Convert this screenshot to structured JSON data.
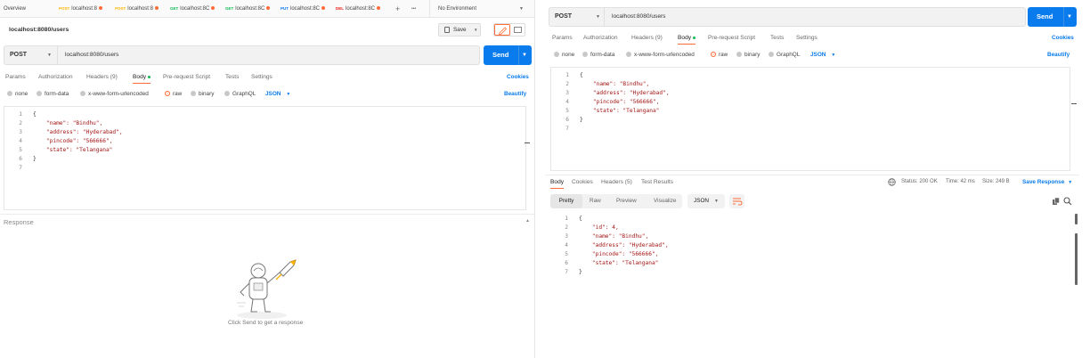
{
  "left": {
    "tabs": [
      {
        "label": "Overview",
        "method": ""
      },
      {
        "label": "localhost:8",
        "method": "POST"
      },
      {
        "label": "localhost:8",
        "method": "POST"
      },
      {
        "label": "localhost:8C",
        "method": "GET"
      },
      {
        "label": "localhost:8C",
        "method": "GET"
      },
      {
        "label": "localhost:8C",
        "method": "PUT"
      },
      {
        "label": "localhost:8C",
        "method": "DEL"
      }
    ],
    "tab_add": "+",
    "tab_more": "•••",
    "environment": "No Environment",
    "request_title": "localhost:8080/users",
    "save_label": "Save",
    "method": "POST",
    "url": "localhost:8080/users",
    "send_label": "Send",
    "subtabs": {
      "params": "Params",
      "auth": "Authorization",
      "headers": "Headers (9)",
      "body": "Body",
      "prerequest": "Pre-request Script",
      "tests": "Tests",
      "settings": "Settings",
      "cookies": "Cookies"
    },
    "body_types": {
      "none": "none",
      "form_data": "form-data",
      "urlencoded": "x-www-form-urlencoded",
      "raw": "raw",
      "binary": "binary",
      "graphql": "GraphQL",
      "format": "JSON",
      "beautify": "Beautify"
    },
    "line_numbers": [
      "1",
      "2",
      "3",
      "4",
      "5",
      "6",
      "7"
    ],
    "code": [
      "{",
      "    \"name\": \"Bindhu\",",
      "    \"address\": \"Hyderabad\",",
      "    \"pincode\": \"566666\",",
      "    \"state\": \"Telangana\"",
      "}",
      ""
    ],
    "response_title": "Response",
    "empty_hint": "Click Send to get a response"
  },
  "right": {
    "method": "POST",
    "url": "localhost:8080/users",
    "send_label": "Send",
    "subtabs": {
      "params": "Params",
      "auth": "Authorization",
      "headers": "Headers (9)",
      "body": "Body",
      "prerequest": "Pre-request Script",
      "tests": "Tests",
      "settings": "Settings",
      "cookies": "Cookies"
    },
    "body_types": {
      "none": "none",
      "form_data": "form-data",
      "urlencoded": "x-www-form-urlencoded",
      "raw": "raw",
      "binary": "binary",
      "graphql": "GraphQL",
      "format": "JSON",
      "beautify": "Beautify"
    },
    "line_numbers": [
      "1",
      "2",
      "3",
      "4",
      "5",
      "6",
      "7"
    ],
    "code": [
      "{",
      "    \"name\": \"Bindhu\",",
      "    \"address\": \"Hyderabad\",",
      "    \"pincode\": \"566666\",",
      "    \"state\": \"Telangana\"",
      "}",
      ""
    ],
    "response_tabs": {
      "body": "Body",
      "cookies": "Cookies",
      "headers": "Headers (5)",
      "tests": "Test Results"
    },
    "status": "Status: 200 OK",
    "time": "Time: 42 ms",
    "size": "Size: 249 B",
    "save_response": "Save Response",
    "view_modes": {
      "pretty": "Pretty",
      "raw": "Raw",
      "preview": "Preview",
      "visualize": "Visualize",
      "format": "JSON"
    },
    "response_line_numbers": [
      "1",
      "2",
      "3",
      "4",
      "5",
      "6",
      "7"
    ],
    "response_code": [
      "{",
      "    \"id\": 4,",
      "    \"name\": \"Bindhu\",",
      "    \"address\": \"Hyderabad\",",
      "    \"pincode\": \"566666\",",
      "    \"state\": \"Telangana\"",
      "}"
    ]
  },
  "colors": {
    "accent": "#ff6c37",
    "send": "#097bed",
    "status_ok": "#0cbb52"
  }
}
